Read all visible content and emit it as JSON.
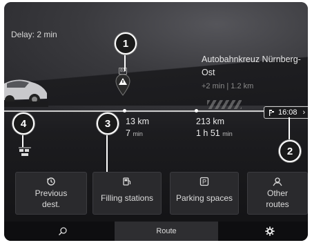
{
  "trip": {
    "delay": "Delay: 2 min"
  },
  "destination": {
    "name": "Autobahnkreuz Nürnberg-Ost",
    "sub": "+2 min | 1.2 km"
  },
  "road_sign": "81",
  "segments": [
    {
      "dist": "13 km",
      "time": "7",
      "time_unit": "min"
    },
    {
      "dist": "213 km",
      "time": "1 h 51",
      "time_unit": "min"
    }
  ],
  "eta": {
    "time": "16:08",
    "chevron": "›"
  },
  "callouts": [
    "1",
    "2",
    "3",
    "4"
  ],
  "tiles": [
    {
      "label1": "Previous",
      "label2": "dest.",
      "icon": "history-icon"
    },
    {
      "label1": "Filling stations",
      "label2": "",
      "icon": "fuel-pump-icon"
    },
    {
      "label1": "Parking spaces",
      "label2": "",
      "icon": "parking-icon"
    },
    {
      "label1": "Other",
      "label2": "routes",
      "icon": "alternate-route-icon"
    }
  ],
  "bottom_nav": {
    "search_icon": "search-icon",
    "route_label": "Route",
    "settings_icon": "gear-icon"
  }
}
